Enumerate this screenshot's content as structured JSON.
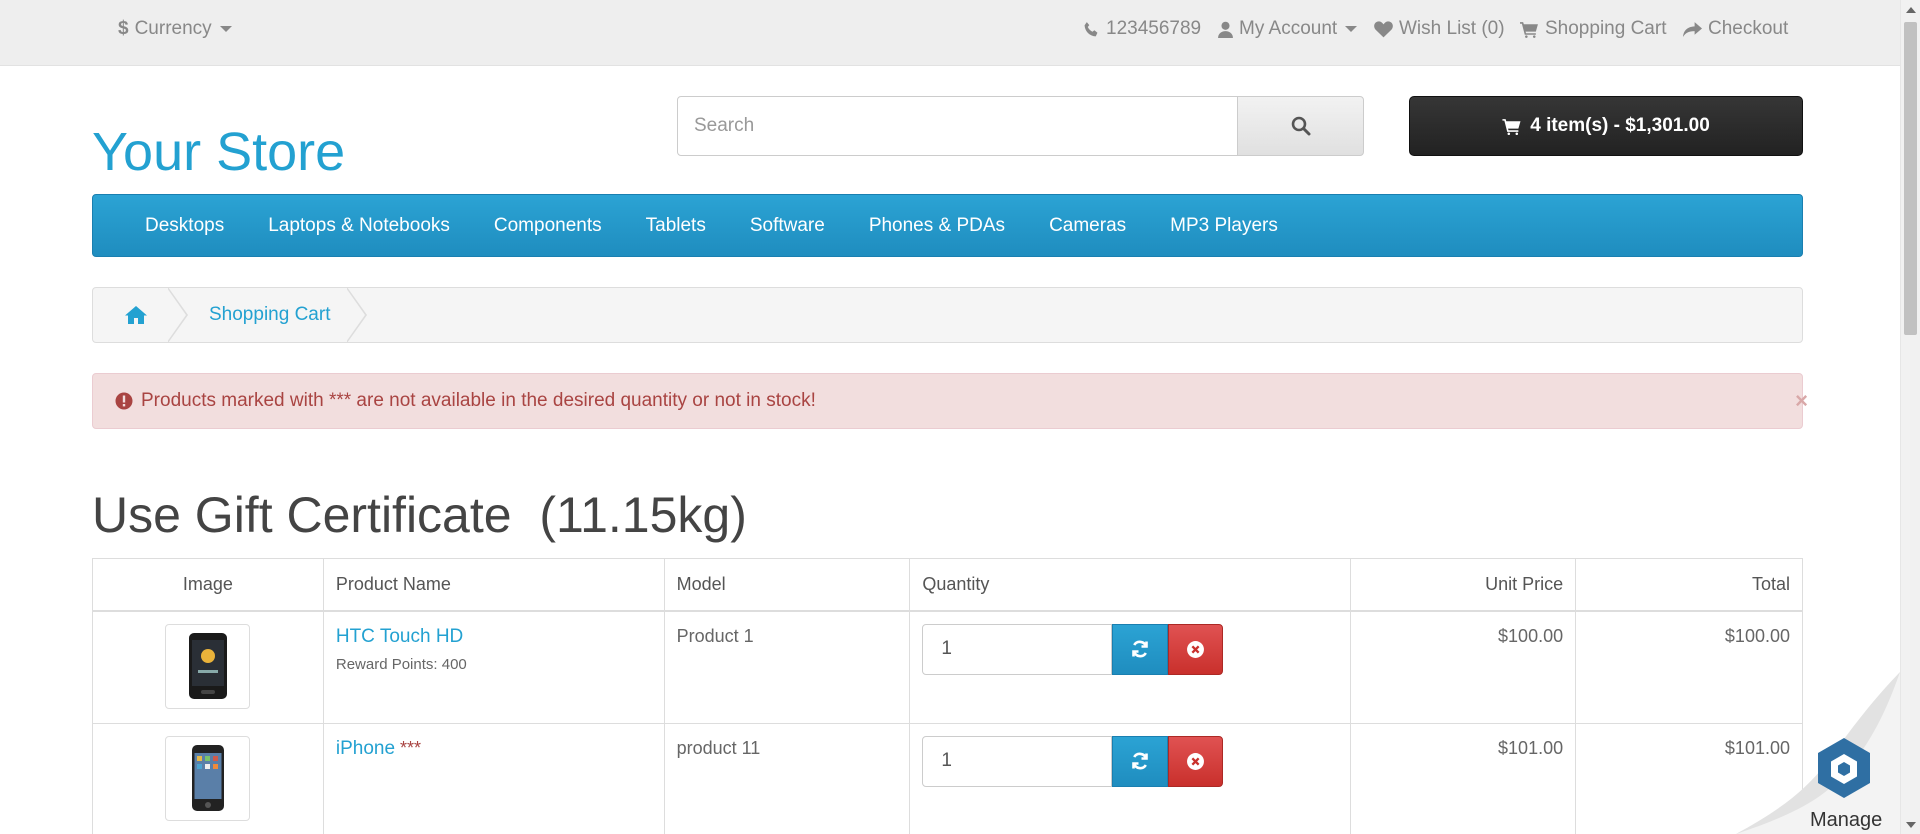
{
  "topbar": {
    "currency_label": "Currency",
    "phone": "123456789",
    "my_account": "My Account",
    "wishlist": "Wish List (0)",
    "shopping_cart": "Shopping Cart",
    "checkout": "Checkout"
  },
  "header": {
    "logo": "Your Store",
    "search_placeholder": "Search",
    "cart_button": "4 item(s) - $1,301.00"
  },
  "menu": {
    "items": [
      "Desktops",
      "Laptops & Notebooks",
      "Components",
      "Tablets",
      "Software",
      "Phones & PDAs",
      "Cameras",
      "MP3 Players"
    ]
  },
  "breadcrumb": {
    "current": "Shopping Cart"
  },
  "alert": {
    "message": "Products marked with *** are not available in the desired quantity or not in stock!",
    "close": "×"
  },
  "page": {
    "title": "Use Gift Certificate  (11.15kg)"
  },
  "table": {
    "headers": [
      "Image",
      "Product Name",
      "Model",
      "Quantity",
      "Unit Price",
      "Total"
    ],
    "rows": [
      {
        "name": "HTC Touch HD",
        "stock_flag": "",
        "reward": "Reward Points: 400",
        "model": "Product 1",
        "quantity": "1",
        "unit_price": "$100.00",
        "total": "$100.00"
      },
      {
        "name": "iPhone",
        "stock_flag": " ***",
        "reward": "",
        "model": "product 11",
        "quantity": "1",
        "unit_price": "$101.00",
        "total": "$101.00"
      }
    ]
  },
  "widget": {
    "manage_label": "Manage"
  },
  "colors": {
    "accent": "#23a1d1",
    "danger": "#c9302c",
    "alert_bg": "#f2dede",
    "cart_button_bg": "#222222"
  }
}
